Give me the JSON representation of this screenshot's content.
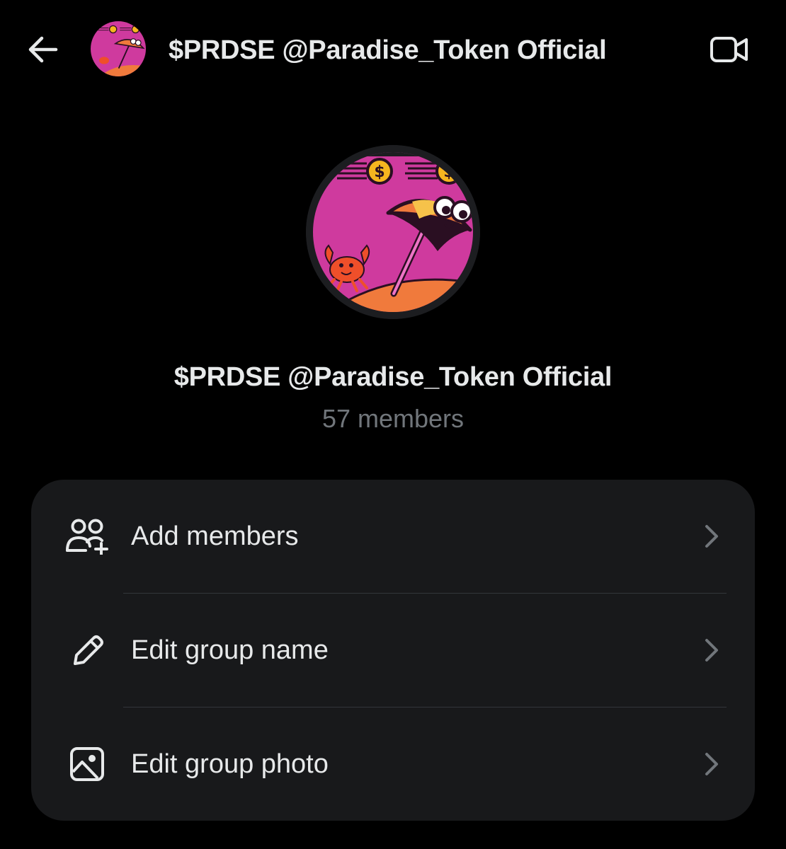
{
  "header": {
    "back_icon": "arrow-left-icon",
    "title": "$PRDSE @Paradise_Token Official",
    "video_icon": "video-camera-icon"
  },
  "profile": {
    "name": "$PRDSE @Paradise_Token Official",
    "members": "57 members"
  },
  "settings": {
    "items": [
      {
        "label": "Add members",
        "icon": "add-members-icon"
      },
      {
        "label": "Edit group name",
        "icon": "pencil-icon"
      },
      {
        "label": "Edit group photo",
        "icon": "image-icon"
      }
    ]
  },
  "colors": {
    "background": "#000000",
    "card": "#18191b",
    "text_primary": "#e7e9ea",
    "text_secondary": "#71767b",
    "avatar_pink": "#cf3a9e",
    "avatar_orange": "#f07a3c"
  }
}
